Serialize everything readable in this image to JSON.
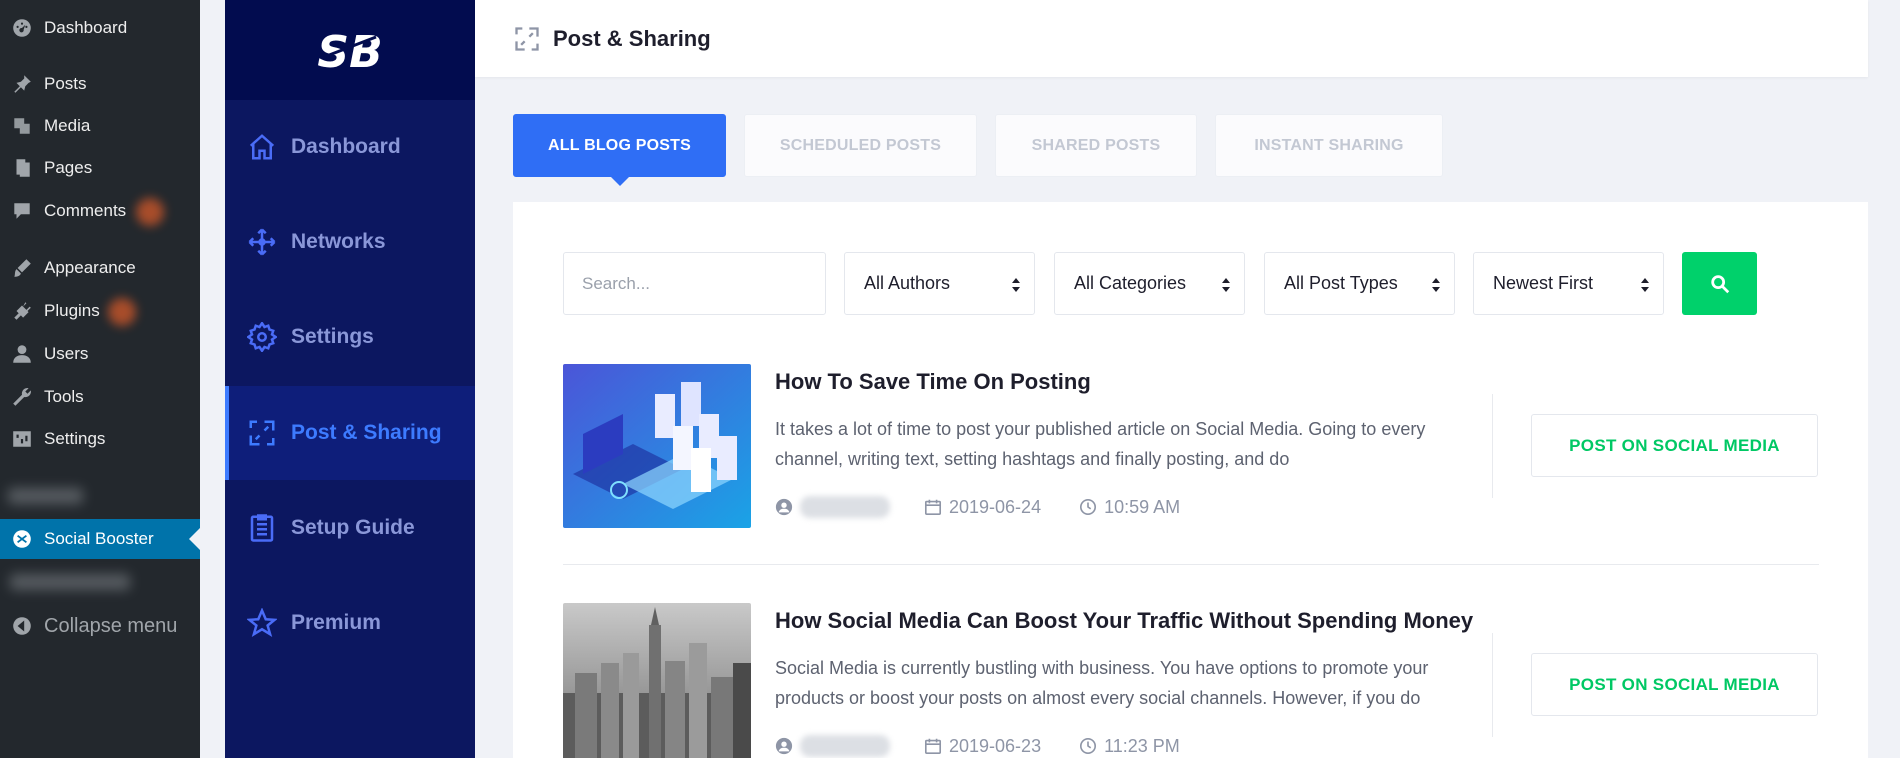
{
  "wp_menu": {
    "items": [
      {
        "label": "Dashboard",
        "icon": "dashboard-icon"
      },
      {
        "label": "Posts",
        "icon": "pin-icon"
      },
      {
        "label": "Media",
        "icon": "media-icon"
      },
      {
        "label": "Pages",
        "icon": "pages-icon"
      },
      {
        "label": "Comments",
        "icon": "comment-icon"
      },
      {
        "label": "Appearance",
        "icon": "brush-icon"
      },
      {
        "label": "Plugins",
        "icon": "plugin-icon"
      },
      {
        "label": "Users",
        "icon": "user-icon"
      },
      {
        "label": "Tools",
        "icon": "wrench-icon"
      },
      {
        "label": "Settings",
        "icon": "settings-icon"
      }
    ],
    "active_item": {
      "label": "Social Booster",
      "icon": "social-booster-icon"
    },
    "collapse": {
      "label": "Collapse menu",
      "icon": "collapse-arrow-icon"
    }
  },
  "plugin_nav": {
    "logo_text": "SB",
    "items": [
      {
        "label": "Dashboard",
        "icon": "home-icon"
      },
      {
        "label": "Networks",
        "icon": "move-arrows-icon"
      },
      {
        "label": "Settings",
        "icon": "gear-icon"
      },
      {
        "label": "Post & Sharing",
        "icon": "share-icon",
        "active": true
      },
      {
        "label": "Setup Guide",
        "icon": "clipboard-icon"
      },
      {
        "label": "Premium",
        "icon": "star-icon"
      }
    ]
  },
  "header": {
    "title": "Post & Sharing",
    "icon": "share-icon"
  },
  "tabs": [
    {
      "label": "ALL BLOG POSTS",
      "active": true
    },
    {
      "label": "SCHEDULED POSTS",
      "active": false
    },
    {
      "label": "SHARED POSTS",
      "active": false
    },
    {
      "label": "INSTANT SHARING",
      "active": false
    }
  ],
  "filters": {
    "search_placeholder": "Search...",
    "author": "All Authors",
    "category": "All Categories",
    "post_type": "All Post Types",
    "order": "Newest First"
  },
  "posts": [
    {
      "title": "How To Save Time On Posting",
      "excerpt": "It takes a lot of time to post your published article on Social Media. Going to every channel, writing text, setting hashtags and finally posting, and do",
      "date": "2019-06-24",
      "time": "10:59 AM",
      "button": "POST ON SOCIAL MEDIA"
    },
    {
      "title": "How Social Media Can Boost Your Traffic Without Spending Money",
      "excerpt": "Social Media is currently bustling with business. You have options to promote your products or boost your posts on almost every social channels. However, if you do",
      "date": "2019-06-23",
      "time": "11:23 PM",
      "button": "POST ON SOCIAL MEDIA"
    }
  ],
  "colors": {
    "wp_sidebar": "#23282d",
    "wp_active": "#0073aa",
    "plugin_sidebar": "#0c1760",
    "accent_blue": "#2f6ef5",
    "accent_green": "#00d16b"
  }
}
